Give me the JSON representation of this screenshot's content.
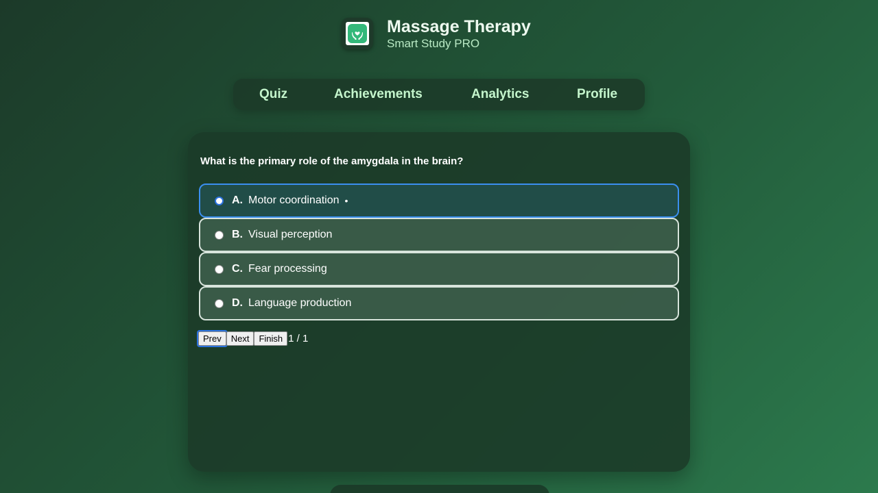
{
  "app": {
    "title": "Massage Therapy",
    "subtitle": "Smart Study PRO",
    "icon": "hands-heart-icon"
  },
  "nav": {
    "items": [
      {
        "label": "Quiz"
      },
      {
        "label": "Achievements"
      },
      {
        "label": "Analytics"
      },
      {
        "label": "Profile"
      }
    ]
  },
  "quiz": {
    "question": "What is the primary role of the amygdala in the brain?",
    "options": [
      {
        "letter": "A.",
        "text": "Motor coordination",
        "marker": "•",
        "selected": true
      },
      {
        "letter": "B.",
        "text": "Visual perception",
        "selected": false
      },
      {
        "letter": "C.",
        "text": "Fear processing",
        "selected": false
      },
      {
        "letter": "D.",
        "text": "Language production",
        "selected": false
      }
    ],
    "controls": {
      "prev_label": "Prev",
      "next_label": "Next",
      "finish_label": "Finish",
      "counter": "1 / 1"
    }
  },
  "colors": {
    "accent": "#3b8ff0",
    "nav_text": "#c4f5cc",
    "brand_green": "#33b87a"
  }
}
